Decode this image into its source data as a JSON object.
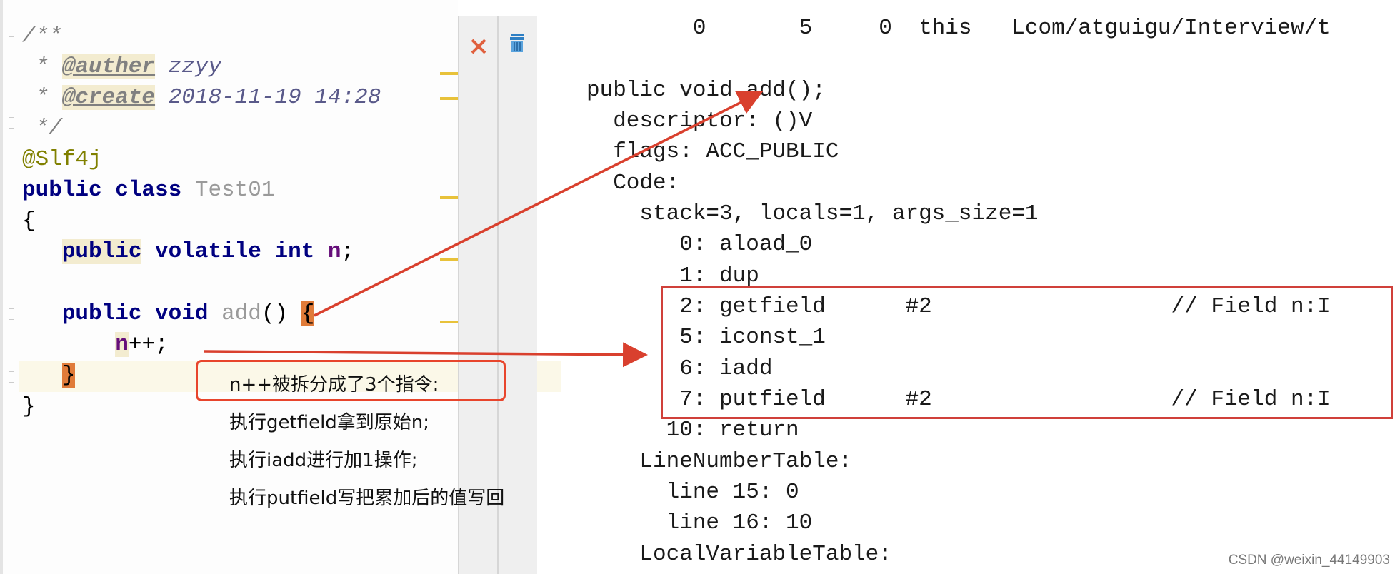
{
  "editor": {
    "lines": [
      [
        {
          "t": "/**",
          "c": "cm"
        }
      ],
      [
        {
          "t": " * ",
          "c": "cm"
        },
        {
          "t": "@auther",
          "c": "tag"
        },
        {
          "t": " zzyy",
          "c": "cmv"
        }
      ],
      [
        {
          "t": " * ",
          "c": "cm"
        },
        {
          "t": "@create",
          "c": "tag"
        },
        {
          "t": " 2018-11-19 14:28",
          "c": "cmv"
        }
      ],
      [
        {
          "t": " */",
          "c": "cm"
        }
      ],
      [
        {
          "t": "@Slf4j",
          "c": "ann"
        }
      ],
      [
        {
          "t": "public class ",
          "c": "kw"
        },
        {
          "t": "Test01",
          "c": "cls"
        }
      ],
      [
        {
          "t": "{",
          "c": ""
        }
      ],
      [
        {
          "t": "   ",
          "c": ""
        },
        {
          "t": "public",
          "c": "kw hl"
        },
        {
          "t": " volatile int ",
          "c": "kw"
        },
        {
          "t": "n",
          "c": "fld"
        },
        {
          "t": ";",
          "c": ""
        }
      ],
      [],
      [
        {
          "t": "   ",
          "c": ""
        },
        {
          "t": "public void ",
          "c": "kw"
        },
        {
          "t": "add",
          "c": "cls"
        },
        {
          "t": "() ",
          "c": ""
        },
        {
          "t": "{",
          "c": "brace"
        }
      ],
      [
        {
          "t": "       ",
          "c": ""
        },
        {
          "t": "n",
          "c": "fld hl"
        },
        {
          "t": "++;",
          "c": ""
        }
      ],
      [
        {
          "t": "   ",
          "c": ""
        },
        {
          "t": "}",
          "c": "brace"
        }
      ],
      [
        {
          "t": "}",
          "c": ""
        }
      ]
    ]
  },
  "gutter_icons": [
    "close-icon",
    "trash-icon"
  ],
  "bytecode": {
    "lines": [
      "        0       5     0  this   Lcom/atguigu/Interview/t",
      "",
      "public void add();",
      "  descriptor: ()V",
      "  flags: ACC_PUBLIC",
      "  Code:",
      "    stack=3, locals=1, args_size=1",
      "       0: aload_0",
      "       1: dup",
      "       2: getfield      #2                  // Field n:I",
      "       5: iconst_1",
      "       6: iadd",
      "       7: putfield      #2                  // Field n:I",
      "      10: return",
      "    LineNumberTable:",
      "      line 15: 0",
      "      line 16: 10",
      "    LocalVariableTable:"
    ]
  },
  "annotation": {
    "title": "n++被拆分成了3个指令:",
    "steps": [
      "执行getfield拿到原始n;",
      "执行iadd进行加1操作;",
      "执行putfield写把累加后的值写回"
    ]
  },
  "colors": {
    "arrow": "#d9402e",
    "box": "#d0403a"
  },
  "watermark": "CSDN @weixin_44149903"
}
